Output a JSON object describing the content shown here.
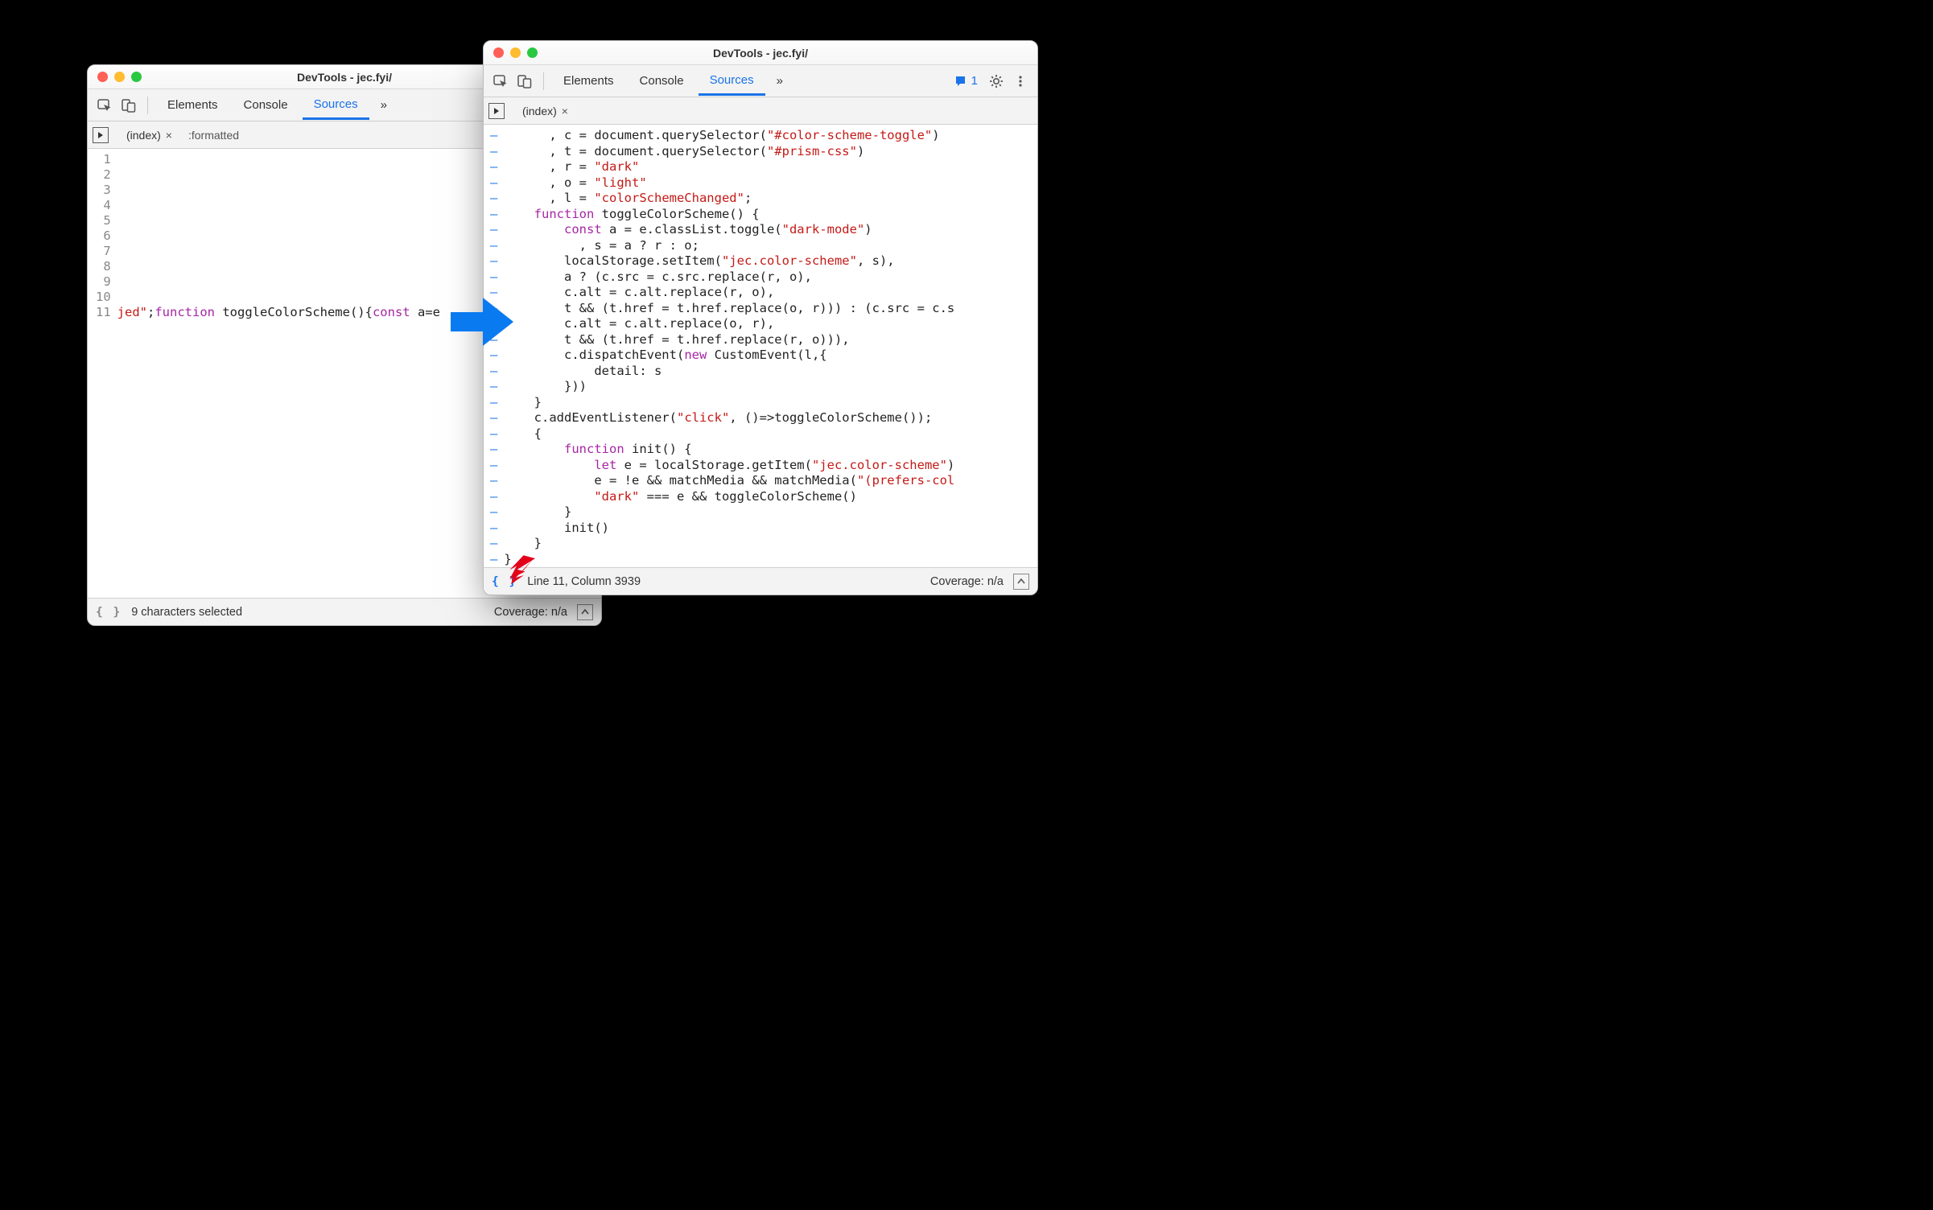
{
  "leftWindow": {
    "title": "DevTools - jec.fyi/",
    "tabs": {
      "elements": "Elements",
      "console": "Console",
      "sources": "Sources"
    },
    "moreGlyph": "»",
    "fileTabs": {
      "index": "(index)",
      "formatted": ":formatted"
    },
    "gutterNumbers": [
      "1",
      "2",
      "3",
      "4",
      "5",
      "6",
      "7",
      "8",
      "9",
      "10",
      "11"
    ],
    "codeLine11": {
      "a": "jed\"",
      "b": ";",
      "c": "function",
      "d": " toggleColorScheme(){",
      "e": "const",
      "f": " a=e"
    },
    "status": {
      "format": "{ }",
      "selection": "9 characters selected",
      "coverage": "Coverage: n/a"
    }
  },
  "rightWindow": {
    "title": "DevTools - jec.fyi/",
    "tabs": {
      "elements": "Elements",
      "console": "Console",
      "sources": "Sources"
    },
    "moreGlyph": "»",
    "issuesCount": "1",
    "fileTabs": {
      "index": "(index)"
    },
    "codeLines": [
      [
        [
          "p",
          "      , c = document.querySelector("
        ],
        [
          "s",
          "\"#color-scheme-toggle\""
        ],
        [
          "p",
          ")"
        ]
      ],
      [
        [
          "p",
          "      , t = document.querySelector("
        ],
        [
          "s",
          "\"#prism-css\""
        ],
        [
          "p",
          ")"
        ]
      ],
      [
        [
          "p",
          "      , r = "
        ],
        [
          "s",
          "\"dark\""
        ]
      ],
      [
        [
          "p",
          "      , o = "
        ],
        [
          "s",
          "\"light\""
        ]
      ],
      [
        [
          "p",
          "      , l = "
        ],
        [
          "s",
          "\"colorSchemeChanged\""
        ],
        [
          "p",
          ";"
        ]
      ],
      [
        [
          "p",
          "    "
        ],
        [
          "k",
          "function"
        ],
        [
          "p",
          " toggleColorScheme() {"
        ]
      ],
      [
        [
          "p",
          "        "
        ],
        [
          "k",
          "const"
        ],
        [
          "p",
          " a = e.classList.toggle("
        ],
        [
          "s",
          "\"dark-mode\""
        ],
        [
          "p",
          ")"
        ]
      ],
      [
        [
          "p",
          "          , s = a ? r : o;"
        ]
      ],
      [
        [
          "p",
          "        localStorage.setItem("
        ],
        [
          "s",
          "\"jec.color-scheme\""
        ],
        [
          "p",
          ", s),"
        ]
      ],
      [
        [
          "p",
          "        a ? (c.src = c.src.replace(r, o),"
        ]
      ],
      [
        [
          "p",
          "        c.alt = c.alt.replace(r, o),"
        ]
      ],
      [
        [
          "p",
          "        t && (t.href = t.href.replace(o, r))) : (c.src = c.s"
        ]
      ],
      [
        [
          "p",
          "        c.alt = c.alt.replace(o, r),"
        ]
      ],
      [
        [
          "p",
          "        t && (t.href = t.href.replace(r, o))),"
        ]
      ],
      [
        [
          "p",
          "        c.dispatchEvent("
        ],
        [
          "k",
          "new"
        ],
        [
          "p",
          " CustomEvent(l,{"
        ]
      ],
      [
        [
          "p",
          "            detail: s"
        ]
      ],
      [
        [
          "p",
          "        }))"
        ]
      ],
      [
        [
          "p",
          "    }"
        ]
      ],
      [
        [
          "p",
          "    c.addEventListener("
        ],
        [
          "s",
          "\"click\""
        ],
        [
          "p",
          ", ()=>toggleColorScheme());"
        ]
      ],
      [
        [
          "p",
          "    {"
        ]
      ],
      [
        [
          "p",
          "        "
        ],
        [
          "k",
          "function"
        ],
        [
          "p",
          " init() {"
        ]
      ],
      [
        [
          "p",
          "            "
        ],
        [
          "k",
          "let"
        ],
        [
          "p",
          " e = localStorage.getItem("
        ],
        [
          "s",
          "\"jec.color-scheme\""
        ],
        [
          "p",
          ")"
        ]
      ],
      [
        [
          "p",
          "            e = !e && matchMedia && matchMedia("
        ],
        [
          "s",
          "\"(prefers-col"
        ]
      ],
      [
        [
          "p",
          "            "
        ],
        [
          "s",
          "\"dark\""
        ],
        [
          "p",
          " === e && toggleColorScheme()"
        ]
      ],
      [
        [
          "p",
          "        }"
        ]
      ],
      [
        [
          "p",
          "        init()"
        ]
      ],
      [
        [
          "p",
          "    }"
        ]
      ],
      [
        [
          "p",
          "}"
        ]
      ]
    ],
    "status": {
      "format": "{ }",
      "position": "Line 11, Column 3939",
      "coverage": "Coverage: n/a"
    }
  }
}
